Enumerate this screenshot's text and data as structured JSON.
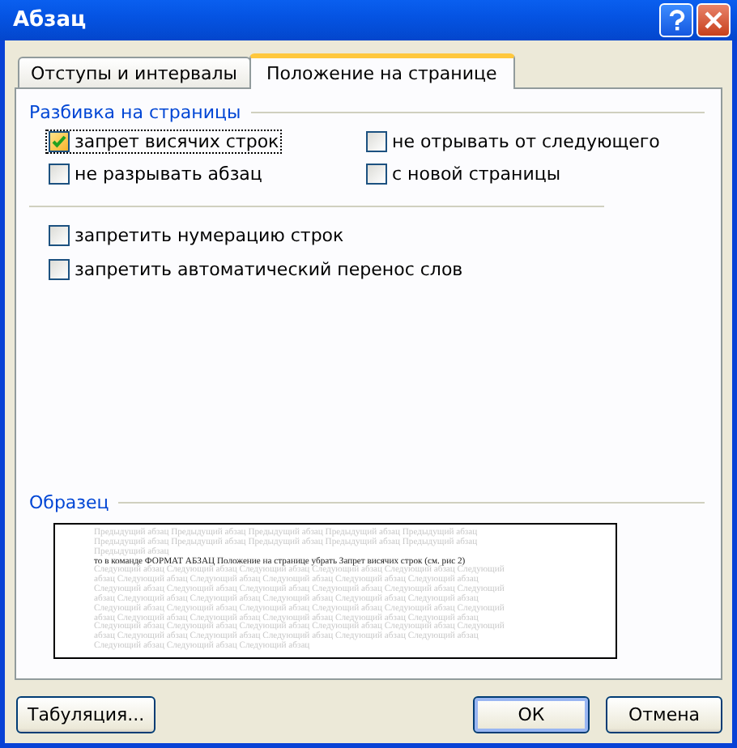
{
  "window": {
    "title": "Абзац"
  },
  "tabs": [
    {
      "label": "Отступы и интервалы",
      "selected": false
    },
    {
      "label": "Положение на странице",
      "selected": true
    }
  ],
  "pagination": {
    "title": "Разбивка на страницы",
    "options": [
      {
        "label": "запрет висячих строк",
        "checked": true,
        "focused": true
      },
      {
        "label": "не отрывать от следующего",
        "checked": false,
        "focused": false
      },
      {
        "label": "не разрывать абзац",
        "checked": false,
        "focused": false
      },
      {
        "label": "с новой страницы",
        "checked": false,
        "focused": false
      }
    ]
  },
  "other_options": [
    {
      "label": "запретить нумерацию строк",
      "checked": false
    },
    {
      "label": "запретить автоматический перенос слов",
      "checked": false
    }
  ],
  "preview": {
    "title": "Образец",
    "lines": [
      {
        "kind": "previous",
        "text": "Предыдущий абзац Предыдущий абзац Предыдущий абзац Предыдущий абзац Предыдущий абзац"
      },
      {
        "kind": "previous",
        "text": "Предыдущий абзац Предыдущий абзац Предыдущий абзац Предыдущий абзац Предыдущий абзац"
      },
      {
        "kind": "previous",
        "text": "Предыдущий абзац"
      },
      {
        "kind": "current",
        "text": "то в команде ФОРМАТ АБЗАЦ Положение на странице убрать Запрет висячих строк (см. рис 2)"
      },
      {
        "kind": "next",
        "text": "Следующий абзац Следующий абзац Следующий абзац Следующий абзац Следующий абзац Следующий"
      },
      {
        "kind": "next",
        "text": "абзац Следующий абзац Следующий абзац Следующий абзац Следующий абзац Следующий абзац"
      },
      {
        "kind": "next",
        "text": "Следующий абзац Следующий абзац Следующий абзац Следующий абзац Следующий абзац Следующий"
      },
      {
        "kind": "next",
        "text": "абзац Следующий абзац Следующий абзац Следующий абзац Следующий абзац Следующий абзац"
      },
      {
        "kind": "next",
        "text": "Следующий абзац Следующий абзац Следующий абзац Следующий абзац Следующий абзац Следующий"
      },
      {
        "kind": "next",
        "text": "абзац Следующий абзац Следующий абзац Следующий абзац Следующий абзац Следующий абзац"
      },
      {
        "kind": "next",
        "text": "Следующий абзац Следующий абзац Следующий абзац Следующий абзац Следующий абзац Следующий"
      },
      {
        "kind": "next",
        "text": "абзац Следующий абзац Следующий абзац Следующий абзац Следующий абзац Следующий абзац"
      },
      {
        "kind": "next",
        "text": "Следующий абзац Следующий абзац Следующий абзац"
      }
    ]
  },
  "buttons": [
    {
      "label": "Табуляция...",
      "kind": "left",
      "default": false
    },
    {
      "label": "ОК",
      "kind": "right",
      "default": true
    },
    {
      "label": "Отмена",
      "kind": "right",
      "default": false
    }
  ]
}
